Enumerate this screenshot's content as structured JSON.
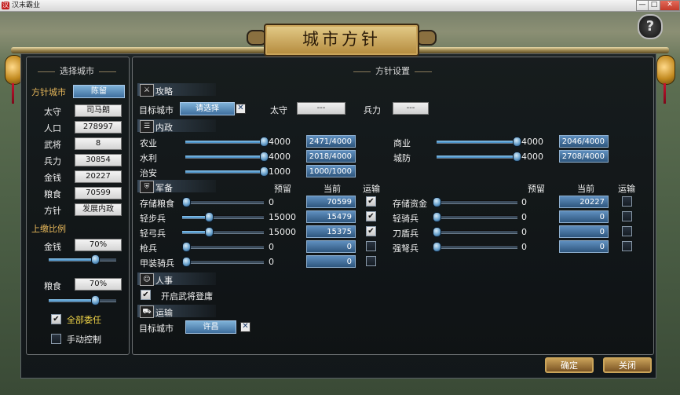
{
  "window": {
    "title": "汉末霸业",
    "min_label": "—",
    "max_label": "□",
    "close_label": "✕",
    "app_icon": "汉"
  },
  "dialog": {
    "title": "城市方针",
    "help_label": "?"
  },
  "left": {
    "header": "选择城市",
    "policy_city_label": "方针城市",
    "policy_city_value": "陈留",
    "fields": [
      {
        "label": "太守",
        "value": "司马朗"
      },
      {
        "label": "人口",
        "value": "278997"
      },
      {
        "label": "武将",
        "value": "8"
      },
      {
        "label": "兵力",
        "value": "30854"
      },
      {
        "label": "金钱",
        "value": "20227"
      },
      {
        "label": "粮食",
        "value": "70599"
      },
      {
        "label": "方针",
        "value": "发展内政"
      }
    ],
    "tribute_label": "上缴比例",
    "money_label": "金钱",
    "money_pct": "70%",
    "money_ratio": 0.7,
    "food_label": "粮食",
    "food_pct": "70%",
    "food_ratio": 0.7,
    "delegate_all_label": "全部委任",
    "delegate_all_checked": true,
    "manual_label": "手动控制",
    "manual_checked": false
  },
  "right": {
    "header": "方针设置",
    "attack": {
      "title": "攻略",
      "target_label": "目标城市",
      "target_value": "请选择",
      "governor_label": "太守",
      "governor_value": "---",
      "troops_label": "兵力",
      "troops_value": "---"
    },
    "internal": {
      "title": "内政",
      "rows": [
        {
          "label": "农业",
          "target": "4000",
          "current": "2471/4000",
          "ratio": 1.0
        },
        {
          "label": "水利",
          "target": "4000",
          "current": "2018/4000",
          "ratio": 1.0
        },
        {
          "label": "治安",
          "target": "1000",
          "current": "1000/1000",
          "ratio": 1.0
        },
        {
          "label": "商业",
          "target": "4000",
          "current": "2046/4000",
          "ratio": 1.0
        },
        {
          "label": "城防",
          "target": "4000",
          "current": "2708/4000",
          "ratio": 1.0
        }
      ]
    },
    "military": {
      "title": "军备",
      "col_reserve": "预留",
      "col_current": "当前",
      "col_transport": "运输",
      "left_rows": [
        {
          "label": "存储粮食",
          "reserve": "0",
          "current": "70599",
          "transport": true,
          "ratio": 0.0
        },
        {
          "label": "轻步兵",
          "reserve": "15000",
          "current": "15479",
          "transport": true,
          "ratio": 0.3
        },
        {
          "label": "轻弓兵",
          "reserve": "15000",
          "current": "15375",
          "transport": true,
          "ratio": 0.3
        },
        {
          "label": "枪兵",
          "reserve": "0",
          "current": "0",
          "transport": false,
          "ratio": 0.0
        },
        {
          "label": "甲装骑兵",
          "reserve": "0",
          "current": "0",
          "transport": false,
          "ratio": 0.0
        }
      ],
      "right_rows": [
        {
          "label": "存储资金",
          "reserve": "0",
          "current": "20227",
          "transport": false,
          "ratio": 0.0
        },
        {
          "label": "轻骑兵",
          "reserve": "0",
          "current": "0",
          "transport": false,
          "ratio": 0.0
        },
        {
          "label": "刀盾兵",
          "reserve": "0",
          "current": "0",
          "transport": false,
          "ratio": 0.0
        },
        {
          "label": "强弩兵",
          "reserve": "0",
          "current": "0",
          "transport": false,
          "ratio": 0.0
        }
      ]
    },
    "personnel": {
      "title": "人事",
      "enable_label": "开启武将登庸",
      "enable_checked": true
    },
    "transport": {
      "title": "运输",
      "target_label": "目标城市",
      "target_value": "许昌"
    }
  },
  "footer": {
    "ok_label": "确定",
    "close_label": "关闭"
  }
}
